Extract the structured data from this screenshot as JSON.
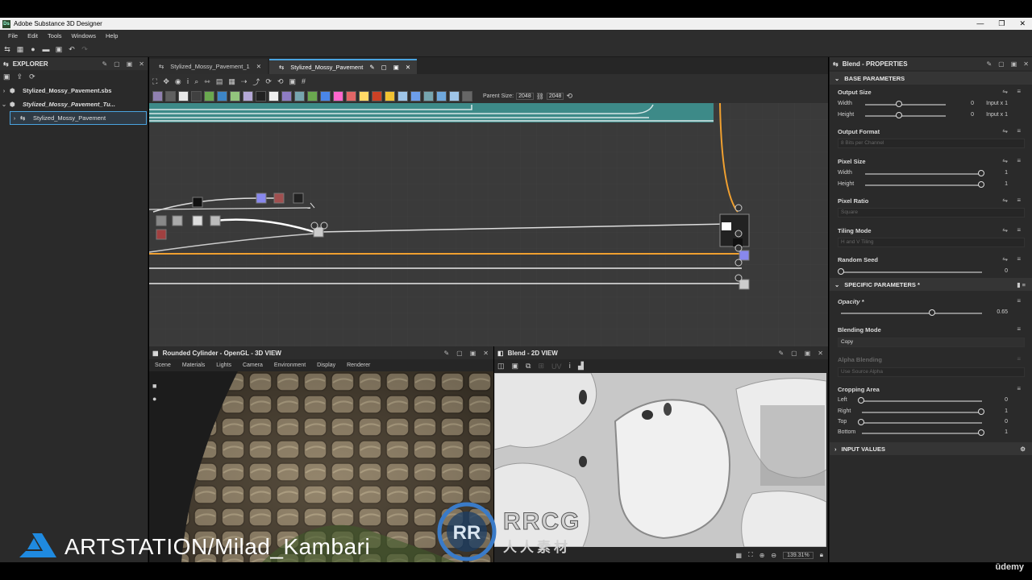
{
  "window": {
    "title": "Adobe Substance 3D Designer",
    "app_badge": "Ds"
  },
  "menu": [
    "File",
    "Edit",
    "Tools",
    "Windows",
    "Help"
  ],
  "explorer": {
    "title": "EXPLORER",
    "items": [
      {
        "label": "Stylized_Mossy_Pavement.sbs"
      },
      {
        "label": "Stylized_Mossy_Pavement_Tu..."
      },
      {
        "label": "Stylized_Mossy_Pavement"
      }
    ]
  },
  "tabs": [
    {
      "label": "Stylized_Mossy_Pavement_1"
    },
    {
      "label": "Stylized_Mossy_Pavement"
    }
  ],
  "graph_toolbar": {
    "parent_size_label": "Parent Size:",
    "parent_size": "2048",
    "size2": "2048"
  },
  "view3d": {
    "title": "Rounded Cylinder - OpenGL - 3D VIEW",
    "menu": [
      "Scene",
      "Materials",
      "Lights",
      "Camera",
      "Environment",
      "Display",
      "Renderer"
    ]
  },
  "view2d": {
    "title": "Blend - 2D VIEW",
    "zoom": "139.31%"
  },
  "properties": {
    "title": "Blend - PROPERTIES",
    "base_section": "BASE PARAMETERS",
    "output_size": {
      "label": "Output Size",
      "width_label": "Width",
      "height_label": "Height",
      "width_val": "0",
      "height_val": "0",
      "width_mode": "Input x 1",
      "height_mode": "Input x 1"
    },
    "output_format": {
      "label": "Output Format",
      "value": "8 Bits per Channel"
    },
    "pixel_size": {
      "label": "Pixel Size",
      "width_label": "Width",
      "height_label": "Height",
      "width_val": "1",
      "height_val": "1"
    },
    "pixel_ratio": {
      "label": "Pixel Ratio",
      "value": "Square"
    },
    "tiling_mode": {
      "label": "Tiling Mode",
      "value": "H and V Tiling"
    },
    "random_seed": {
      "label": "Random Seed",
      "value": "0"
    },
    "specific_section": "SPECIFIC PARAMETERS *",
    "opacity": {
      "label": "Opacity *",
      "value": "0.65"
    },
    "blending_mode": {
      "label": "Blending Mode",
      "value": "Copy"
    },
    "alpha_blending": {
      "label": "Alpha Blending",
      "value": "Use Source Alpha"
    },
    "cropping": {
      "label": "Cropping Area",
      "left_label": "Left",
      "right_label": "Right",
      "top_label": "Top",
      "bottom_label": "Bottom",
      "left": "0",
      "right": "1",
      "top": "0",
      "bottom": "1"
    },
    "input_section": "INPUT VALUES"
  },
  "watermark": {
    "text": "ARTSTATION/Milad_Kambari",
    "brand": "RRCG",
    "sub": "人人素材"
  },
  "udemy": "ūdemy",
  "colors": {
    "accent": "#4aa3df",
    "graph_bg": "#3a3a3a",
    "teal_frame": "#3d8a88",
    "orange_wire": "#f0a030"
  }
}
